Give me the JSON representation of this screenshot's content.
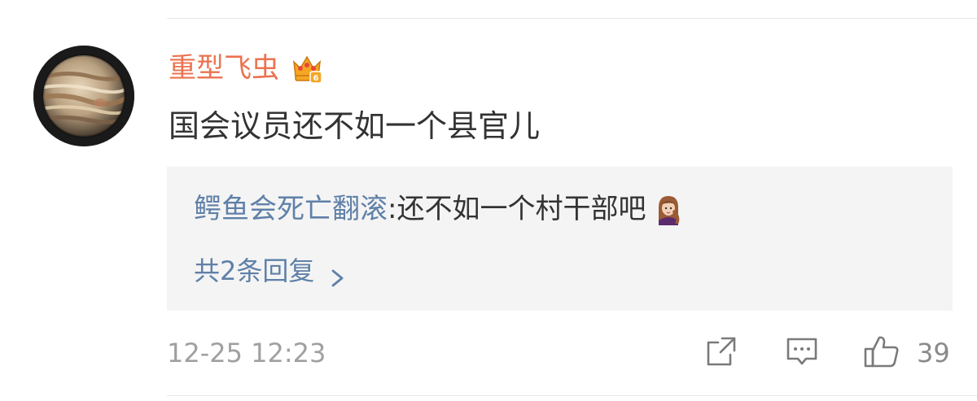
{
  "comment": {
    "username": "重型飞虫",
    "text": "国会议员还不如一个县官儿",
    "timestamp": "12-25 12:23",
    "like_count": "39",
    "badge_icon": "vip-crown-icon"
  },
  "reply": {
    "username": "鳄鱼会死亡翻滚",
    "separator": ": ",
    "text": "还不如一个村干部吧",
    "emoji": "anna-emoji-icon",
    "more_label": "共2条回复"
  },
  "actions": {
    "forward_icon": "share-icon",
    "comment_icon": "comment-icon",
    "like_icon": "thumbs-up-icon"
  },
  "colors": {
    "username": "#eb7350",
    "reply_username": "#5f80a8",
    "text": "#333333",
    "meta": "#a0a0a0",
    "reply_bg": "#f4f4f4"
  }
}
